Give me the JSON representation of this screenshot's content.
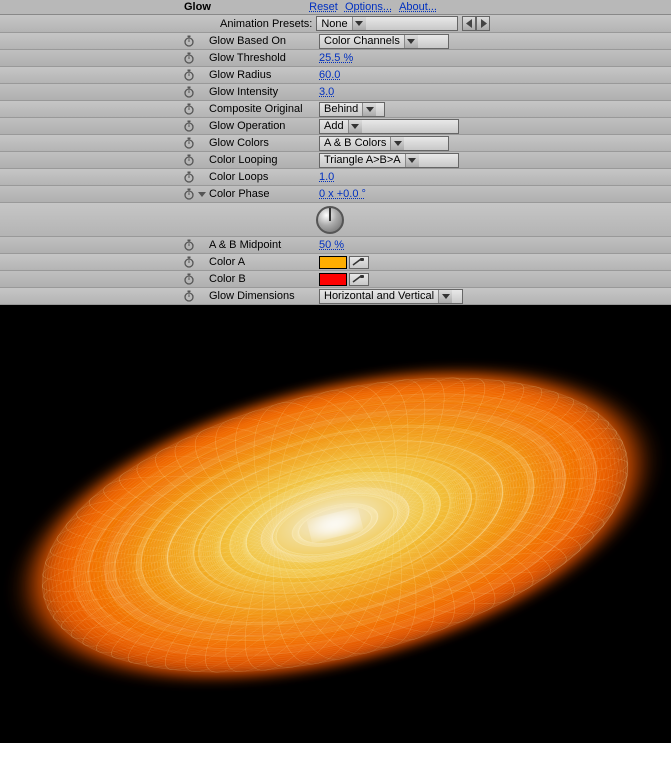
{
  "effect": {
    "name": "Glow",
    "links": {
      "reset": "Reset",
      "options": "Options...",
      "about": "About..."
    }
  },
  "presets": {
    "label": "Animation Presets:",
    "value": "None"
  },
  "params": {
    "glowBasedOn": {
      "label": "Glow Based On",
      "value": "Color Channels",
      "type": "select",
      "width": 130
    },
    "glowThreshold": {
      "label": "Glow Threshold",
      "value": "25.5 %",
      "type": "value"
    },
    "glowRadius": {
      "label": "Glow Radius",
      "value": "60.0",
      "type": "value"
    },
    "glowIntensity": {
      "label": "Glow Intensity",
      "value": "3.0",
      "type": "value"
    },
    "compositeOrig": {
      "label": "Composite Original",
      "value": "Behind",
      "type": "select",
      "width": 66
    },
    "glowOperation": {
      "label": "Glow Operation",
      "value": "Add",
      "type": "select",
      "width": 140
    },
    "glowColors": {
      "label": "Glow Colors",
      "value": "A & B Colors",
      "type": "select",
      "width": 130
    },
    "colorLooping": {
      "label": "Color Looping",
      "value": "Triangle A>B>A",
      "type": "select",
      "width": 140
    },
    "colorLoops": {
      "label": "Color Loops",
      "value": "1.0",
      "type": "value"
    },
    "colorPhase": {
      "label": "Color Phase",
      "value": "0 x +0.0 °",
      "type": "dial"
    },
    "abMidpoint": {
      "label": "A & B Midpoint",
      "value": "50 %",
      "type": "value"
    },
    "colorA": {
      "label": "Color A",
      "value": "#ffae00",
      "type": "color"
    },
    "colorB": {
      "label": "Color B",
      "value": "#ff0000",
      "type": "color"
    },
    "glowDimensions": {
      "label": "Glow Dimensions",
      "value": "Horizontal and Vertical",
      "type": "select",
      "width": 144
    }
  }
}
